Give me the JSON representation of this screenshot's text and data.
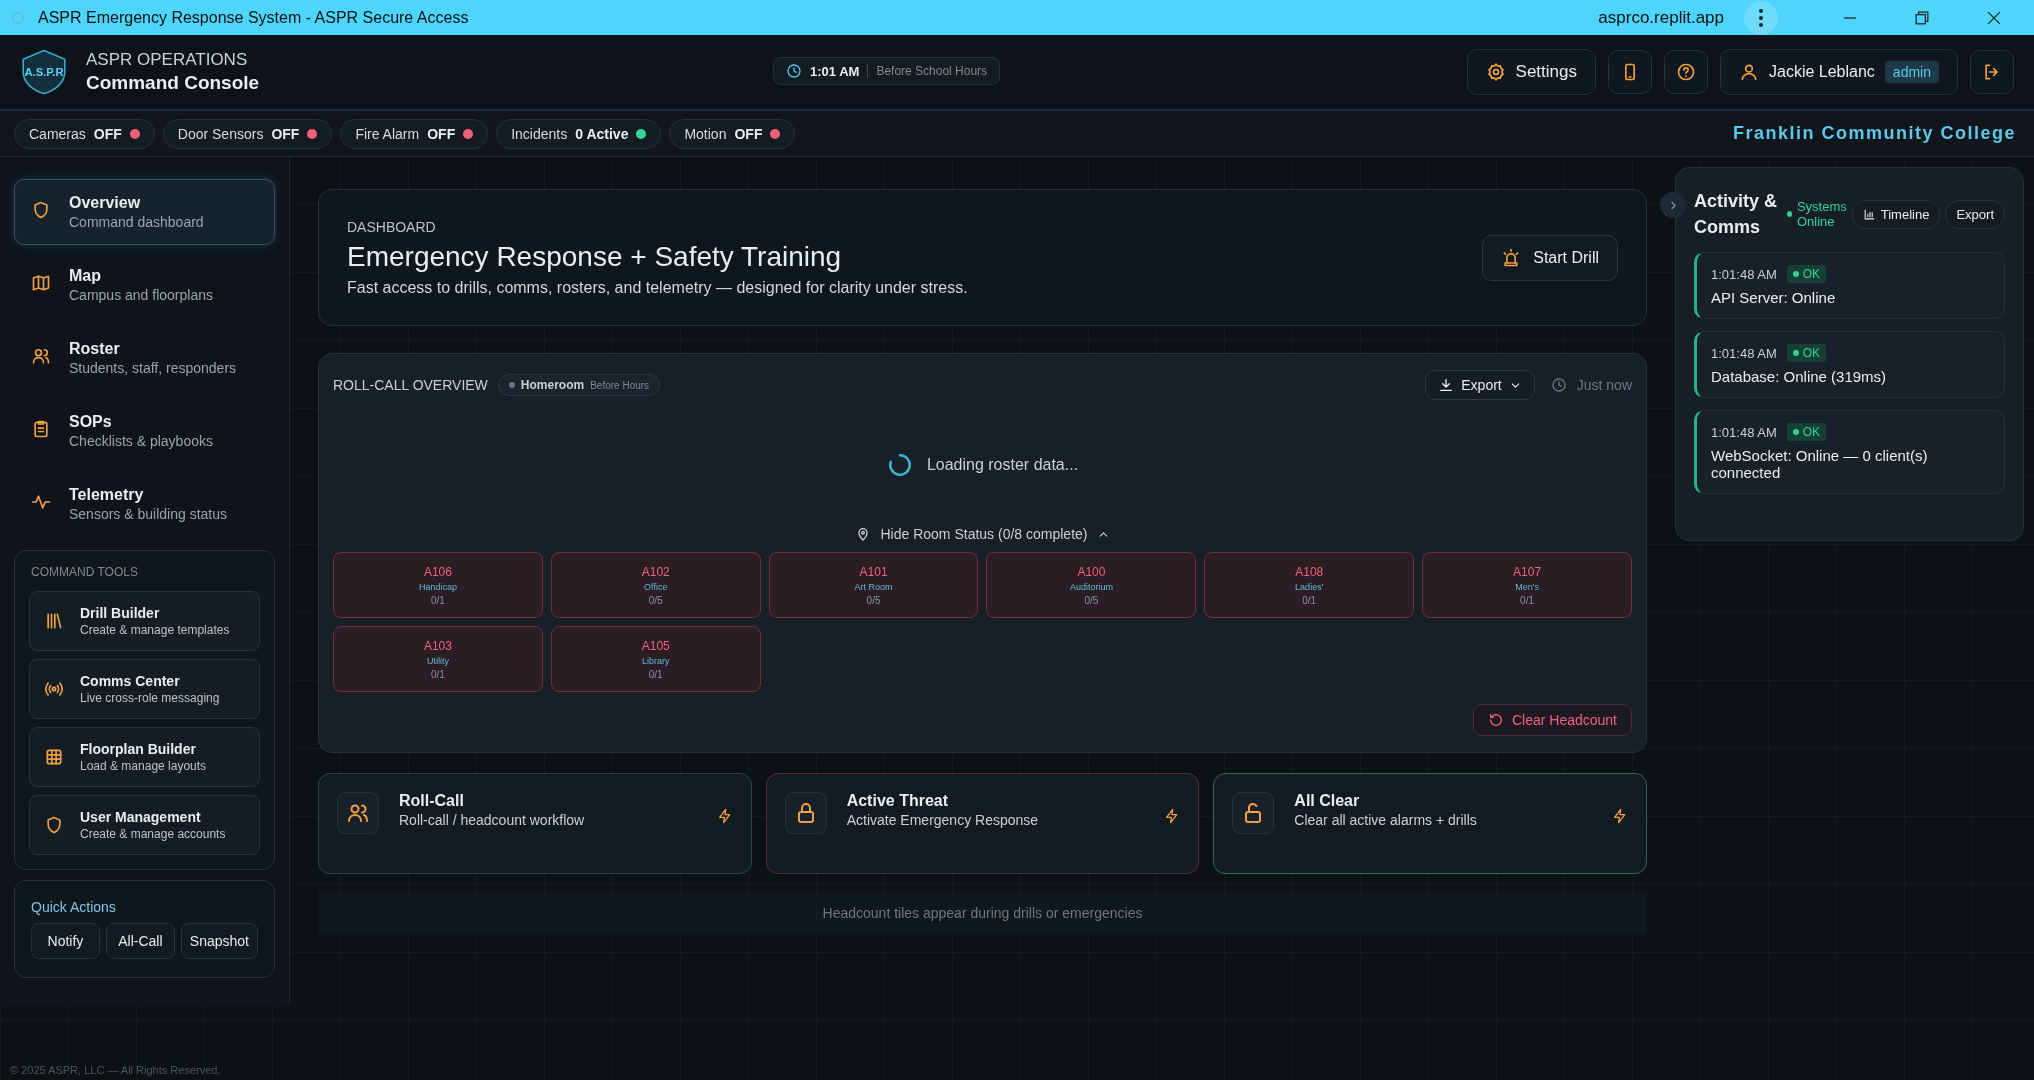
{
  "window": {
    "title": "ASPR Emergency Response System - ASPR Secure Access",
    "address": "asprco.replit.app"
  },
  "header": {
    "eyebrow": "ASPR OPERATIONS",
    "title": "Command Console",
    "logo_text": "A.S.P.R",
    "clock": {
      "time": "1:01 AM",
      "period": "Before School Hours"
    },
    "settings_label": "Settings",
    "user": {
      "name": "Jackie Leblanc",
      "role": "admin"
    }
  },
  "status_chips": [
    {
      "label": "Cameras",
      "value": "OFF",
      "color": "#f0607a"
    },
    {
      "label": "Door Sensors",
      "value": "OFF",
      "color": "#f0607a"
    },
    {
      "label": "Fire Alarm",
      "value": "OFF",
      "color": "#f0607a"
    },
    {
      "label": "Incidents",
      "value": "0 Active",
      "color": "#34d399"
    },
    {
      "label": "Motion",
      "value": "OFF",
      "color": "#f0607a"
    }
  ],
  "organization": "Franklin Community College",
  "sidebar": {
    "items": [
      {
        "kind": "shield",
        "title": "Overview",
        "subtitle": "Command dashboard",
        "selected": true
      },
      {
        "kind": "map",
        "title": "Map",
        "subtitle": "Campus and floorplans",
        "selected": false
      },
      {
        "kind": "people",
        "title": "Roster",
        "subtitle": "Students, staff, responders",
        "selected": false
      },
      {
        "kind": "clipboard",
        "title": "SOPs",
        "subtitle": "Checklists & playbooks",
        "selected": false
      },
      {
        "kind": "pulse",
        "title": "Telemetry",
        "subtitle": "Sensors & building status",
        "selected": false
      }
    ],
    "tools_heading": "COMMAND TOOLS",
    "tools": [
      {
        "kind": "library",
        "title": "Drill Builder",
        "subtitle": "Create & manage templates"
      },
      {
        "kind": "broadcast",
        "title": "Comms Center",
        "subtitle": "Live cross-role messaging"
      },
      {
        "kind": "grid",
        "title": "Floorplan Builder",
        "subtitle": "Load & manage layouts"
      },
      {
        "kind": "shield",
        "title": "User Management",
        "subtitle": "Create & manage accounts"
      }
    ],
    "quick_actions": {
      "heading": "Quick Actions",
      "buttons": [
        "Notify",
        "All-Call",
        "Snapshot"
      ]
    }
  },
  "dashboard": {
    "eyebrow": "DASHBOARD",
    "title": "Emergency Response + Safety Training",
    "subtitle": "Fast access to drills, comms, rosters, and telemetry — designed for clarity under stress.",
    "start_button": "Start Drill"
  },
  "roll_call": {
    "heading": "ROLL-CALL OVERVIEW",
    "mode": "Homeroom",
    "mode_note": "Before Hours",
    "export_label": "Export",
    "updated": "Just now",
    "loading": "Loading roster data...",
    "toggle": "Hide Room Status (0/8 complete)",
    "clear_button": "Clear Headcount",
    "rooms": [
      {
        "code": "A106",
        "name": "Handicap",
        "count": "0/1"
      },
      {
        "code": "A102",
        "name": "Office",
        "count": "0/5"
      },
      {
        "code": "A101",
        "name": "Art Room",
        "count": "0/5"
      },
      {
        "code": "A100",
        "name": "Auditorium",
        "count": "0/5"
      },
      {
        "code": "A108",
        "name": "Ladies'",
        "count": "0/1"
      },
      {
        "code": "A107",
        "name": "Men's",
        "count": "0/1"
      },
      {
        "code": "A103",
        "name": "Utility",
        "count": "0/1"
      },
      {
        "code": "A105",
        "name": "Library",
        "count": "0/1"
      }
    ]
  },
  "actions": [
    {
      "kind": "rollcall",
      "title": "Roll-Call",
      "subtitle": "Roll-call / headcount workflow"
    },
    {
      "kind": "threat",
      "title": "Active Threat",
      "subtitle": "Activate Emergency Response"
    },
    {
      "kind": "clear",
      "title": "All Clear",
      "subtitle": "Clear all active alarms + drills"
    }
  ],
  "headcount_note": "Headcount tiles appear during drills or emergencies",
  "activity": {
    "title": "Activity & Comms",
    "status": "Systems Online",
    "timeline_button": "Timeline",
    "export_button": "Export",
    "entries": [
      {
        "time": "1:01:48 AM",
        "badge": "OK",
        "message": "API Server: Online"
      },
      {
        "time": "1:01:48 AM",
        "badge": "OK",
        "message": "Database: Online (319ms)"
      },
      {
        "time": "1:01:48 AM",
        "badge": "OK",
        "message": "WebSocket: Online — 0 client(s) connected"
      }
    ]
  },
  "footer": "© 2025 ASPR, LLC — All Rights Reserved."
}
